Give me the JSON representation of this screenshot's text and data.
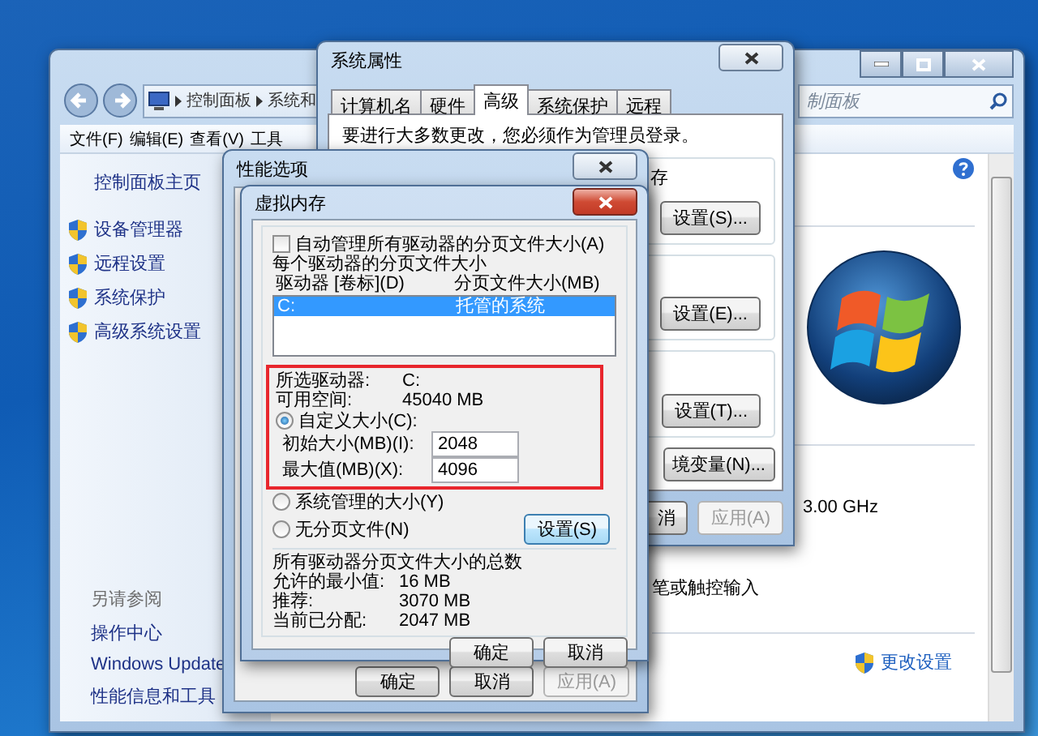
{
  "control_panel": {
    "address": [
      "控制面板",
      "系统和"
    ],
    "search": {
      "placeholder": "制面板"
    },
    "menu": [
      "文件(F)",
      "编辑(E)",
      "查看(V)",
      "工具"
    ],
    "sidebar": {
      "home": "控制面板主页",
      "links": [
        "设备管理器",
        "远程设置",
        "系统保护",
        "高级系统设置"
      ],
      "see_also_title": "另请参阅",
      "see_also": [
        "操作中心",
        "Windows Update",
        "性能信息和工具"
      ]
    },
    "content": {
      "processor_speed": "3.00 GHz",
      "pen_touch": "笔或触控输入",
      "change_settings": "更改设置"
    }
  },
  "system_properties": {
    "title": "系统属性",
    "tabs": [
      {
        "label": "计算机名",
        "selected": false
      },
      {
        "label": "硬件",
        "selected": false
      },
      {
        "label": "高级",
        "selected": true
      },
      {
        "label": "系统保护",
        "selected": false
      },
      {
        "label": "远程",
        "selected": false
      }
    ],
    "notice": "要进行大多数更改，您必须作为管理员登录。",
    "performance_group_fragment": "存",
    "group_buttons": [
      "设置(S)...",
      "设置(E)...",
      "设置(T)..."
    ],
    "env_button": "境变量(N)...",
    "footer_buttons": [
      {
        "label": "消",
        "disabled": false
      },
      {
        "label": "应用(A)",
        "disabled": true
      }
    ]
  },
  "performance_options": {
    "title": "性能选项",
    "footer_buttons": [
      {
        "label": "确定",
        "disabled": false
      },
      {
        "label": "取消",
        "disabled": false
      },
      {
        "label": "应用(A)",
        "disabled": true
      }
    ]
  },
  "virtual_memory": {
    "title": "虚拟内存",
    "auto_manage": {
      "label": "自动管理所有驱动器的分页文件大小(A)",
      "checked": false
    },
    "group_label": "每个驱动器的分页文件大小",
    "columns": [
      "驱动器 [卷标](D)",
      "分页文件大小(MB)"
    ],
    "drives": [
      {
        "drive": "C:",
        "size": "托管的系统",
        "selected": true
      }
    ],
    "selected_drive": {
      "label": "所选驱动器:",
      "value": "C:"
    },
    "free_space": {
      "label": "可用空间:",
      "value": "45040 MB"
    },
    "size_options": [
      {
        "label": "自定义大小(C):",
        "selected": true
      },
      {
        "label": "系统管理的大小(Y)",
        "selected": false
      },
      {
        "label": "无分页文件(N)",
        "selected": false
      }
    ],
    "fields": [
      {
        "label": "初始大小(MB)(I):",
        "value": "2048"
      },
      {
        "label": "最大值(MB)(X):",
        "value": "4096"
      }
    ],
    "set_button": "设置(S)",
    "totals_title": "所有驱动器分页文件大小的总数",
    "totals": [
      {
        "label": "允许的最小值:",
        "value": "16 MB"
      },
      {
        "label": "推荐:",
        "value": "3070 MB"
      },
      {
        "label": "当前已分配:",
        "value": "2047 MB"
      }
    ],
    "buttons": [
      "确定",
      "取消"
    ]
  }
}
